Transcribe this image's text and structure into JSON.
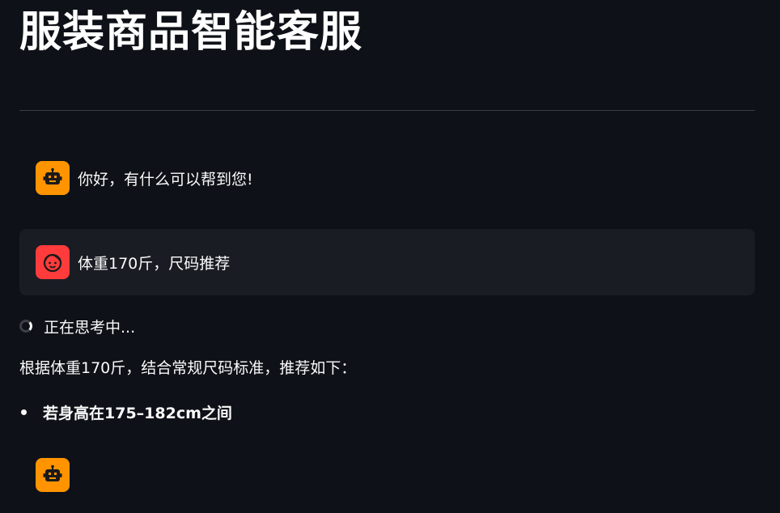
{
  "page": {
    "title": "服装商品智能客服"
  },
  "chat": {
    "messages": [
      {
        "role": "assistant",
        "avatar_icon": "robot-icon",
        "text": "你好，有什么可以帮到您!"
      },
      {
        "role": "user",
        "avatar_icon": "user-face-icon",
        "text": "体重170斤，尺码推荐"
      }
    ],
    "status_text": "正在思考中...",
    "answer_text": "根据体重170斤，结合常规尺码标准，推荐如下：",
    "bullets": [
      "若身高在175–182cm之间"
    ]
  },
  "colors": {
    "background": "#0e1117",
    "assistant_avatar": "#ff9400",
    "user_avatar": "#ff3b3b",
    "user_message_bg": "#1a1c24"
  }
}
